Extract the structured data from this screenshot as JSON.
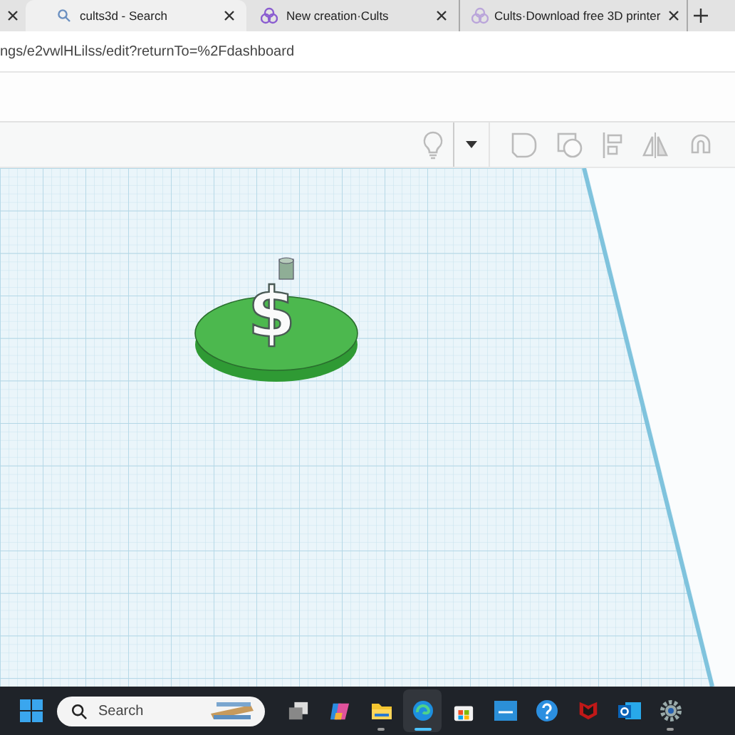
{
  "tabs": [
    {
      "selected": false,
      "kind": "plain"
    },
    {
      "title": "cults3d - Search",
      "selected": true,
      "kind": "search"
    },
    {
      "title": "New creation·Cults",
      "selected": false,
      "kind": "site"
    },
    {
      "title": "Cults·Download free 3D printer",
      "selected": false,
      "kind": "site-loading"
    }
  ],
  "address": "ngs/e2vwlHLilss/edit?returnTo=%2Fdashboard",
  "toolbar": [
    {
      "kind": "bulb"
    },
    {
      "kind": "caret"
    },
    {
      "kind": "shape"
    },
    {
      "kind": "hole"
    },
    {
      "kind": "align"
    },
    {
      "kind": "mirror"
    },
    {
      "kind": "magnet"
    }
  ],
  "model": {
    "symbol": "$"
  },
  "taskbar": {
    "search_placeholder": "Search",
    "apps": [
      {
        "kind": "taskview",
        "running": false,
        "selected": false
      },
      {
        "kind": "copilot",
        "running": false,
        "selected": false
      },
      {
        "kind": "files",
        "running": true,
        "selected": false
      },
      {
        "kind": "edge",
        "running": true,
        "selected": true
      },
      {
        "kind": "store",
        "running": false,
        "selected": false
      },
      {
        "kind": "mydp",
        "running": false,
        "selected": false
      },
      {
        "kind": "help",
        "running": false,
        "selected": false
      },
      {
        "kind": "mcafee",
        "running": false,
        "selected": false
      },
      {
        "kind": "outlook",
        "running": false,
        "selected": false
      },
      {
        "kind": "settings",
        "running": true,
        "selected": false
      }
    ]
  }
}
